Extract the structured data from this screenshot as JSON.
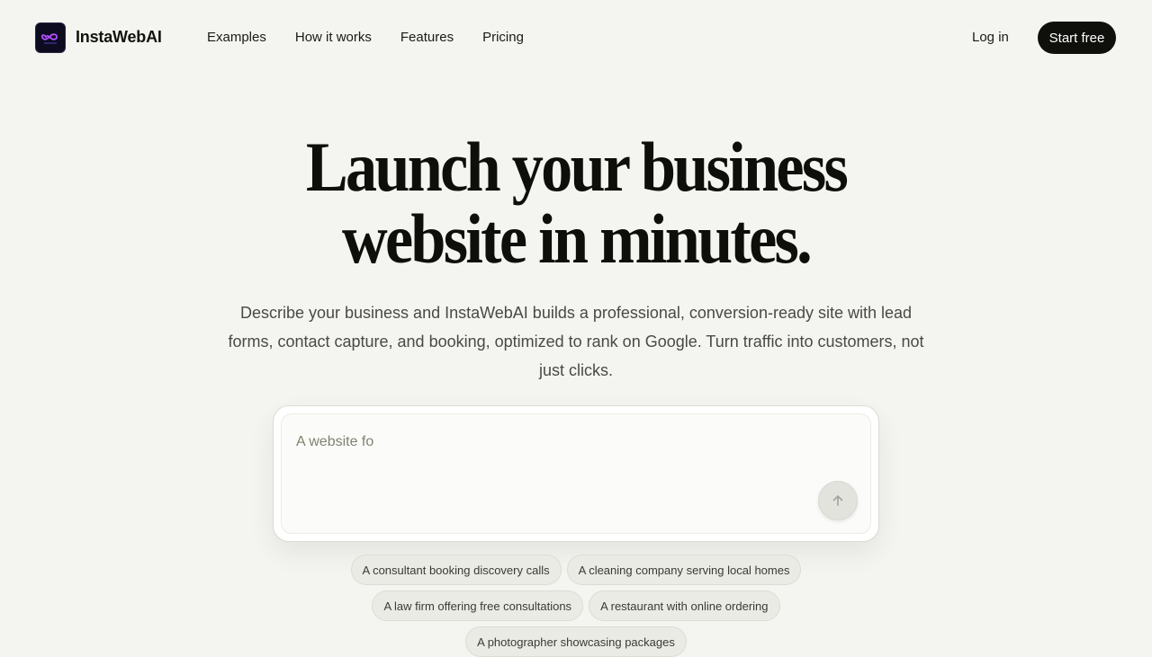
{
  "header": {
    "brand": "InstaWebAI",
    "logo_icon": "infinity-logo-icon",
    "nav": [
      "Examples",
      "How it works",
      "Features",
      "Pricing"
    ],
    "login_label": "Log in",
    "cta_label": "Start free"
  },
  "hero": {
    "title_line1": "Launch your business",
    "title_line2": "website in minutes.",
    "subtitle": "Describe your business and InstaWebAI builds a professional, conversion-ready site with lead forms, contact capture, and booking, optimized to rank on Google. Turn traffic into customers, not just clicks."
  },
  "prompt": {
    "value": "A website fo",
    "send_icon": "arrow-up-icon"
  },
  "suggestions": [
    "A consultant booking discovery calls",
    "A cleaning company serving local homes",
    "A law firm offering free consultations",
    "A restaurant with online ordering",
    "A photographer showcasing packages"
  ],
  "colors": {
    "background": "#f4f4f0",
    "primary_button": "#0f100c",
    "logo_bg": "#0d0b1f",
    "logo_accent": "#b44cff"
  }
}
